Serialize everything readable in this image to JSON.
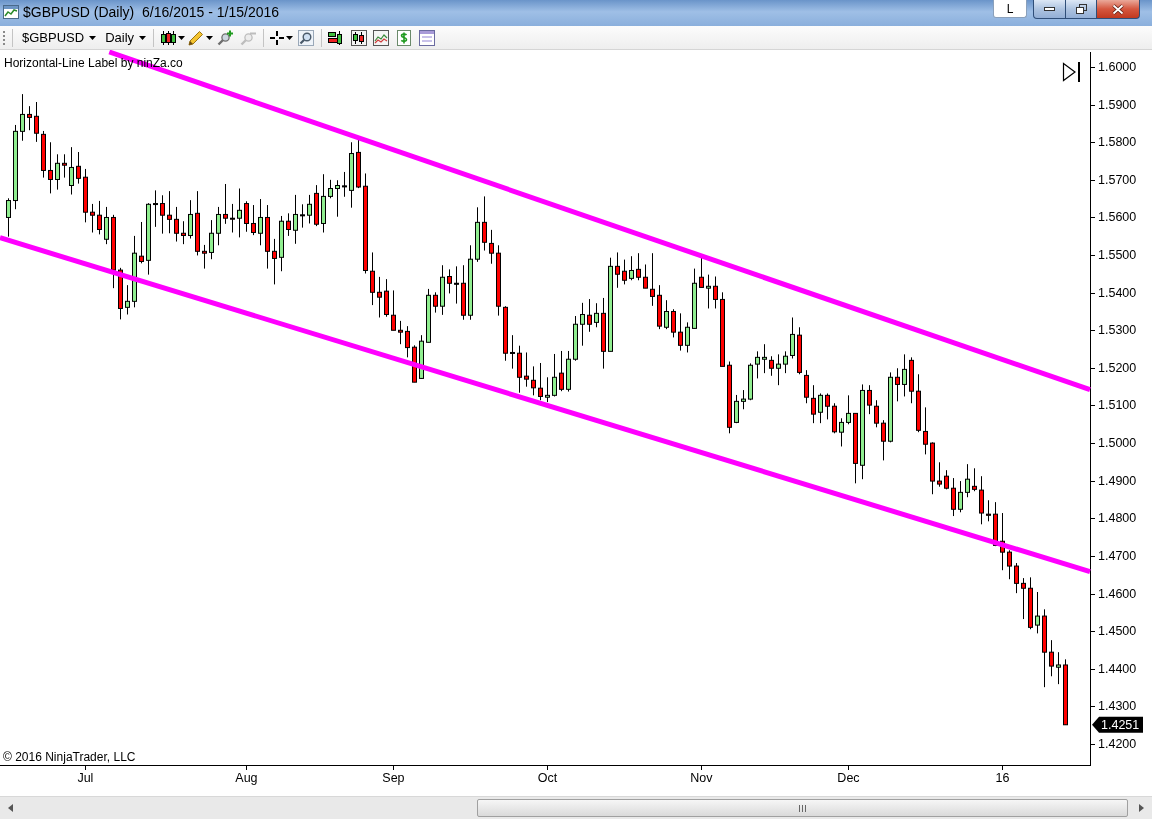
{
  "window": {
    "title": "$GBPUSD (Daily)  6/16/2015 - 1/15/2016",
    "link_button": "L"
  },
  "toolbar": {
    "instrument": "$GBPUSD",
    "period": "Daily"
  },
  "chart": {
    "indicator_label": "Horizontal-Line Label by ninZa.co",
    "chart_data": {
      "type": "candlestick",
      "ylim": [
        1.4144,
        1.604
      ],
      "categories": [
        null,
        null,
        null,
        null,
        null,
        null,
        null,
        null,
        null,
        null,
        null,
        "Jul",
        null,
        null,
        null,
        null,
        null,
        null,
        null,
        null,
        null,
        null,
        null,
        null,
        null,
        null,
        null,
        null,
        null,
        null,
        null,
        null,
        null,
        null,
        "Aug",
        null,
        null,
        null,
        null,
        null,
        null,
        null,
        null,
        null,
        null,
        null,
        null,
        null,
        null,
        null,
        null,
        null,
        null,
        null,
        null,
        "Sep",
        null,
        null,
        null,
        null,
        null,
        null,
        null,
        null,
        null,
        null,
        null,
        null,
        null,
        null,
        null,
        null,
        null,
        null,
        null,
        null,
        null,
        "Oct",
        null,
        null,
        null,
        null,
        null,
        null,
        null,
        null,
        null,
        null,
        null,
        null,
        null,
        null,
        null,
        null,
        null,
        null,
        null,
        null,
        null,
        "Nov",
        null,
        null,
        null,
        null,
        null,
        null,
        null,
        null,
        null,
        null,
        null,
        null,
        null,
        null,
        null,
        null,
        null,
        null,
        null,
        null,
        "Dec",
        null,
        null,
        null,
        null,
        null,
        null,
        null,
        null,
        null,
        null,
        null,
        null,
        null,
        null,
        null,
        null,
        null,
        null,
        null,
        null,
        null,
        "16",
        null,
        null,
        null,
        null,
        null,
        null,
        null,
        null,
        null,
        null,
        null,
        null
      ],
      "yticks": [
        {
          "value": 1.42,
          "label": "1.4200"
        },
        {
          "value": 1.43,
          "label": "1.4300"
        },
        {
          "value": 1.44,
          "label": "1.4400"
        },
        {
          "value": 1.45,
          "label": "1.4500"
        },
        {
          "value": 1.46,
          "label": "1.4600"
        },
        {
          "value": 1.47,
          "label": "1.4700"
        },
        {
          "value": 1.48,
          "label": "1.4800"
        },
        {
          "value": 1.49,
          "label": "1.4900"
        },
        {
          "value": 1.5,
          "label": "1.5000"
        },
        {
          "value": 1.51,
          "label": "1.5100"
        },
        {
          "value": 1.52,
          "label": "1.5200"
        },
        {
          "value": 1.53,
          "label": "1.5300"
        },
        {
          "value": 1.54,
          "label": "1.5400"
        },
        {
          "value": 1.55,
          "label": "1.5500"
        },
        {
          "value": 1.56,
          "label": "1.5600"
        },
        {
          "value": 1.57,
          "label": "1.5700"
        },
        {
          "value": 1.58,
          "label": "1.5800"
        },
        {
          "value": 1.59,
          "label": "1.5900"
        },
        {
          "value": 1.6,
          "label": "1.6000"
        }
      ],
      "ohlc": [
        [
          1.56,
          1.5651,
          1.5549,
          1.5645
        ],
        [
          1.5645,
          1.5846,
          1.5622,
          1.5829
        ],
        [
          1.5829,
          1.5928,
          1.5804,
          1.5874
        ],
        [
          1.5874,
          1.5896,
          1.5832,
          1.5866
        ],
        [
          1.5869,
          1.5907,
          1.5801,
          1.5824
        ],
        [
          1.5821,
          1.583,
          1.5706,
          1.5725
        ],
        [
          1.5725,
          1.58,
          1.5664,
          1.5701
        ],
        [
          1.5701,
          1.5768,
          1.5674,
          1.5744
        ],
        [
          1.5744,
          1.5768,
          1.5706,
          1.5739
        ],
        [
          1.5685,
          1.5787,
          1.5661,
          1.5733
        ],
        [
          1.5736,
          1.5774,
          1.569,
          1.5704
        ],
        [
          1.5707,
          1.5729,
          1.5587,
          1.5614
        ],
        [
          1.5614,
          1.5636,
          1.556,
          1.5606
        ],
        [
          1.5606,
          1.5644,
          1.5555,
          1.5568
        ],
        [
          1.5542,
          1.5628,
          1.5529,
          1.56
        ],
        [
          1.56,
          1.5607,
          1.5412,
          1.546
        ],
        [
          1.546,
          1.5466,
          1.5329,
          1.5358
        ],
        [
          1.5361,
          1.542,
          1.5342,
          1.5377
        ],
        [
          1.5377,
          1.5551,
          1.5361,
          1.5505
        ],
        [
          1.5497,
          1.5588,
          1.5478,
          1.5483
        ],
        [
          1.5486,
          1.5638,
          1.5448,
          1.5635
        ],
        [
          1.5637,
          1.5672,
          1.5575,
          1.5635
        ],
        [
          1.5637,
          1.5659,
          1.5557,
          1.5606
        ],
        [
          1.5606,
          1.567,
          1.5558,
          1.5595
        ],
        [
          1.5595,
          1.5628,
          1.5536,
          1.5558
        ],
        [
          1.5558,
          1.559,
          1.5529,
          1.5552
        ],
        [
          1.5552,
          1.5646,
          1.5544,
          1.5608
        ],
        [
          1.5611,
          1.567,
          1.5499,
          1.551
        ],
        [
          1.551,
          1.5527,
          1.5464,
          1.5505
        ],
        [
          1.5507,
          1.5593,
          1.5489,
          1.5558
        ],
        [
          1.5558,
          1.5628,
          1.5526,
          1.5608
        ],
        [
          1.5608,
          1.5689,
          1.5583,
          1.5598
        ],
        [
          1.5598,
          1.5636,
          1.556,
          1.5597
        ],
        [
          1.5598,
          1.5677,
          1.5547,
          1.5619
        ],
        [
          1.5637,
          1.5643,
          1.5562,
          1.5584
        ],
        [
          1.5584,
          1.5633,
          1.5553,
          1.556
        ],
        [
          1.5558,
          1.5649,
          1.5526,
          1.56
        ],
        [
          1.56,
          1.5633,
          1.5464,
          1.551
        ],
        [
          1.551,
          1.5543,
          1.5422,
          1.5491
        ],
        [
          1.5494,
          1.5604,
          1.5457,
          1.559
        ],
        [
          1.559,
          1.5611,
          1.5551,
          1.5568
        ],
        [
          1.5566,
          1.566,
          1.553,
          1.5608
        ],
        [
          1.5607,
          1.5635,
          1.5573,
          1.5607
        ],
        [
          1.5606,
          1.566,
          1.5584,
          1.5635
        ],
        [
          1.5664,
          1.5686,
          1.5577,
          1.5582
        ],
        [
          1.5584,
          1.5715,
          1.556,
          1.5656
        ],
        [
          1.5656,
          1.57,
          1.5651,
          1.5677
        ],
        [
          1.5677,
          1.5699,
          1.5602,
          1.5685
        ],
        [
          1.5684,
          1.5721,
          1.5655,
          1.5684
        ],
        [
          1.5672,
          1.58,
          1.5626,
          1.577
        ],
        [
          1.5773,
          1.581,
          1.5678,
          1.5681
        ],
        [
          1.5683,
          1.5717,
          1.5451,
          1.5459
        ],
        [
          1.5457,
          1.5507,
          1.5367,
          1.5401
        ],
        [
          1.5401,
          1.5442,
          1.5334,
          1.5388
        ],
        [
          1.5404,
          1.5436,
          1.5336,
          1.5342
        ],
        [
          1.534,
          1.5406,
          1.53,
          1.53
        ],
        [
          1.53,
          1.5325,
          1.5263,
          1.5295
        ],
        [
          1.5297,
          1.5311,
          1.5228,
          1.5254
        ],
        [
          1.5255,
          1.526,
          1.5162,
          1.5162
        ],
        [
          1.5172,
          1.5287,
          1.5171,
          1.5271
        ],
        [
          1.5268,
          1.541,
          1.5268,
          1.5393
        ],
        [
          1.5393,
          1.5401,
          1.5347,
          1.5364
        ],
        [
          1.5364,
          1.5473,
          1.5341,
          1.5441
        ],
        [
          1.5443,
          1.5462,
          1.5398,
          1.5425
        ],
        [
          1.5425,
          1.547,
          1.5371,
          1.5425
        ],
        [
          1.5425,
          1.5473,
          1.5328,
          1.534
        ],
        [
          1.534,
          1.5526,
          1.5328,
          1.5489
        ],
        [
          1.5489,
          1.5627,
          1.5482,
          1.5587
        ],
        [
          1.5587,
          1.5656,
          1.5512,
          1.5534
        ],
        [
          1.5531,
          1.5567,
          1.5477,
          1.5505
        ],
        [
          1.5505,
          1.5526,
          1.5339,
          1.5364
        ],
        [
          1.5361,
          1.5364,
          1.5219,
          1.5239
        ],
        [
          1.5241,
          1.5287,
          1.5198,
          1.5241
        ],
        [
          1.5239,
          1.5259,
          1.5134,
          1.5175
        ],
        [
          1.5178,
          1.5241,
          1.515,
          1.517
        ],
        [
          1.5167,
          1.5204,
          1.5127,
          1.5147
        ],
        [
          1.5146,
          1.5213,
          1.5114,
          1.5124
        ],
        [
          1.5122,
          1.5175,
          1.5109,
          1.5127
        ],
        [
          1.5127,
          1.5237,
          1.5124,
          1.5175
        ],
        [
          1.5186,
          1.5245,
          1.5138,
          1.5143
        ],
        [
          1.5143,
          1.5245,
          1.5137,
          1.5223
        ],
        [
          1.5223,
          1.5338,
          1.5219,
          1.5316
        ],
        [
          1.5316,
          1.5373,
          1.5259,
          1.5342
        ],
        [
          1.534,
          1.5383,
          1.5296,
          1.5316
        ],
        [
          1.5321,
          1.5372,
          1.5308,
          1.5345
        ],
        [
          1.5345,
          1.5386,
          1.5198,
          1.5244
        ],
        [
          1.5244,
          1.5493,
          1.5244,
          1.547
        ],
        [
          1.547,
          1.5507,
          1.5413,
          1.5449
        ],
        [
          1.5457,
          1.5488,
          1.5422,
          1.5433
        ],
        [
          1.5438,
          1.5497,
          1.5433,
          1.5459
        ],
        [
          1.5462,
          1.5505,
          1.5433,
          1.5441
        ],
        [
          1.5441,
          1.5475,
          1.5412,
          1.5412
        ],
        [
          1.5409,
          1.5505,
          1.5365,
          1.539
        ],
        [
          1.5393,
          1.542,
          1.5303,
          1.5311
        ],
        [
          1.5308,
          1.538,
          1.5303,
          1.535
        ],
        [
          1.535,
          1.5356,
          1.5281,
          1.5295
        ],
        [
          1.5295,
          1.5345,
          1.5246,
          1.526
        ],
        [
          1.526,
          1.5321,
          1.5241,
          1.5308
        ],
        [
          1.5305,
          1.5464,
          1.5305,
          1.5425
        ],
        [
          1.5441,
          1.5494,
          1.5414,
          1.5414
        ],
        [
          1.5412,
          1.5448,
          1.5358,
          1.5417
        ],
        [
          1.5417,
          1.5443,
          1.5358,
          1.5382
        ],
        [
          1.5382,
          1.5401,
          1.5204,
          1.5204
        ],
        [
          1.5207,
          1.5217,
          1.5026,
          1.5042
        ],
        [
          1.5055,
          1.5128,
          1.5053,
          1.5111
        ],
        [
          1.5111,
          1.5141,
          1.509,
          1.5117
        ],
        [
          1.5117,
          1.5212,
          1.5114,
          1.5207
        ],
        [
          1.521,
          1.5244,
          1.5172,
          1.5228
        ],
        [
          1.5223,
          1.5263,
          1.5186,
          1.5228
        ],
        [
          1.522,
          1.5231,
          1.5179,
          1.5199
        ],
        [
          1.5199,
          1.5236,
          1.5154,
          1.521
        ],
        [
          1.521,
          1.5244,
          1.5186,
          1.5231
        ],
        [
          1.5233,
          1.5334,
          1.5225,
          1.5289
        ],
        [
          1.5287,
          1.5308,
          1.5183,
          1.5188
        ],
        [
          1.518,
          1.5194,
          1.5106,
          1.5122
        ],
        [
          1.5119,
          1.5154,
          1.5053,
          1.5077
        ],
        [
          1.5082,
          1.5132,
          1.5053,
          1.5127
        ],
        [
          1.5127,
          1.5132,
          1.5063,
          1.5098
        ],
        [
          1.5098,
          1.5106,
          1.5026,
          1.503
        ],
        [
          1.5029,
          1.5066,
          1.4991,
          1.5055
        ],
        [
          1.5055,
          1.5127,
          1.505,
          1.5079
        ],
        [
          1.5079,
          1.5079,
          1.4893,
          1.4946
        ],
        [
          1.4941,
          1.5156,
          1.4904,
          1.514
        ],
        [
          1.514,
          1.5154,
          1.5077,
          1.5101
        ],
        [
          1.5098,
          1.5114,
          1.5042,
          1.5053
        ],
        [
          1.5053,
          1.5061,
          1.4954,
          1.5005
        ],
        [
          1.5005,
          1.5188,
          1.5002,
          1.5175
        ],
        [
          1.5175,
          1.5199,
          1.5111,
          1.5156
        ],
        [
          1.5156,
          1.5236,
          1.5124,
          1.5196
        ],
        [
          1.522,
          1.5228,
          1.5106,
          1.5138
        ],
        [
          1.5138,
          1.5183,
          1.5029,
          1.5034
        ],
        [
          1.5031,
          1.5095,
          1.497,
          1.4997
        ],
        [
          1.5,
          1.5002,
          1.4864,
          1.4899
        ],
        [
          1.4899,
          1.4949,
          1.4884,
          1.4891
        ],
        [
          1.4912,
          1.4928,
          1.4877,
          1.488
        ],
        [
          1.488,
          1.4907,
          1.4806,
          1.4824
        ],
        [
          1.4824,
          1.4899,
          1.4816,
          1.4869
        ],
        [
          1.4869,
          1.4944,
          1.4856,
          1.4904
        ],
        [
          1.4885,
          1.4933,
          1.4872,
          1.4877
        ],
        [
          1.4875,
          1.4912,
          1.4784,
          1.4814
        ],
        [
          1.4811,
          1.4848,
          1.4792,
          1.4808
        ],
        [
          1.4811,
          1.4843,
          1.4726,
          1.4728
        ],
        [
          1.4739,
          1.4814,
          1.4662,
          1.471
        ],
        [
          1.471,
          1.4715,
          1.4638,
          1.4673
        ],
        [
          1.4673,
          1.4681,
          1.4601,
          1.4627
        ],
        [
          1.4627,
          1.4641,
          1.4532,
          1.4614
        ],
        [
          1.4614,
          1.4643,
          1.4505,
          1.451
        ],
        [
          1.4516,
          1.4604,
          1.4494,
          1.454
        ],
        [
          1.454,
          1.4558,
          1.4351,
          1.4444
        ],
        [
          1.4444,
          1.4476,
          1.438,
          1.4407
        ],
        [
          1.4404,
          1.4444,
          1.4359,
          1.441
        ],
        [
          1.441,
          1.4425,
          1.4251,
          1.4251
        ],
        null,
        null,
        null
      ]
    },
    "last_price": "1.4251",
    "copyright": "© 2016 NinjaTrader, LLC"
  }
}
